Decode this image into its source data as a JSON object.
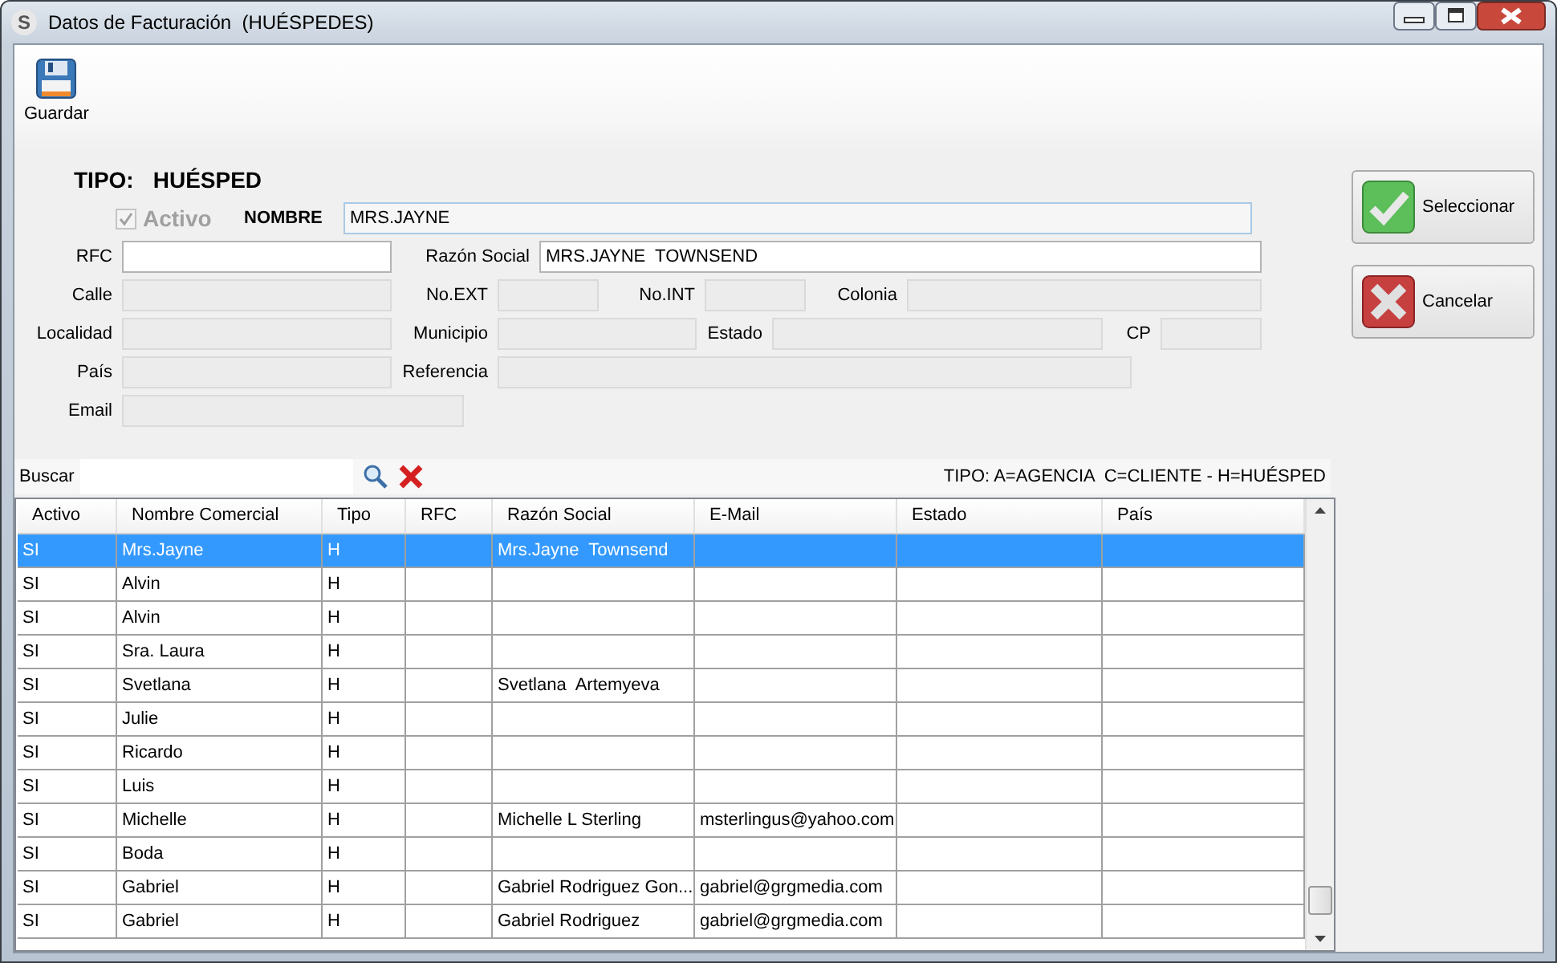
{
  "window": {
    "icon_letter": "S",
    "title": "Datos de Facturación  (HUÉSPEDES)"
  },
  "toolbar": [
    {
      "label": "Guardar"
    }
  ],
  "form": {
    "tipo_label": "TIPO:",
    "tipo_value": "HUÉSPED",
    "activo": {
      "label": "Activo",
      "checked": true,
      "disabled": true
    },
    "nombre": {
      "label": "NOMBRE",
      "value": "MRS.JAYNE"
    },
    "fields": [
      {
        "label": "RFC",
        "disabled": false
      },
      {
        "label": "Razón Social",
        "value": "MRS.JAYNE  TOWNSEND",
        "disabled": false
      },
      {
        "label": "Calle",
        "disabled": true
      },
      {
        "label": "No.EXT",
        "disabled": true
      },
      {
        "label": "No.INT",
        "disabled": true
      },
      {
        "label": "Colonia",
        "disabled": true
      },
      {
        "label": "Localidad",
        "disabled": true
      },
      {
        "label": "Municipio",
        "disabled": true
      },
      {
        "label": "Estado",
        "disabled": true
      },
      {
        "label": "CP",
        "disabled": true
      },
      {
        "label": "País",
        "disabled": true
      },
      {
        "label": "Referencia",
        "disabled": true
      },
      {
        "label": "Email",
        "disabled": true
      }
    ]
  },
  "actions": [
    {
      "kind": "accept",
      "label": "Seleccionar"
    },
    {
      "kind": "cancel",
      "label": "Cancelar"
    }
  ],
  "search": {
    "label": "Buscar",
    "legend": "TIPO: A=AGENCIA  C=CLIENTE - H=HUÉSPED"
  },
  "table": {
    "columns": [
      "Activo",
      "Nombre Comercial",
      "Tipo",
      "RFC",
      "Razón Social",
      "E-Mail",
      "Estado",
      "País"
    ],
    "rows": [
      {
        "selected": true,
        "activo": "SI",
        "nombre": "Mrs.Jayne",
        "tipo": "H",
        "razon_social": "Mrs.Jayne  Townsend"
      },
      {
        "selected": false,
        "activo": "SI",
        "nombre": "Alvin",
        "tipo": "H"
      },
      {
        "selected": false,
        "activo": "SI",
        "nombre": "Alvin",
        "tipo": "H"
      },
      {
        "selected": false,
        "activo": "SI",
        "nombre": "Sra. Laura",
        "tipo": "H"
      },
      {
        "selected": false,
        "activo": "SI",
        "nombre": "Svetlana",
        "tipo": "H",
        "razon_social": "Svetlana  Artemyeva"
      },
      {
        "selected": false,
        "activo": "SI",
        "nombre": "Julie",
        "tipo": "H"
      },
      {
        "selected": false,
        "activo": "SI",
        "nombre": "Ricardo",
        "tipo": "H"
      },
      {
        "selected": false,
        "activo": "SI",
        "nombre": "Luis",
        "tipo": "H"
      },
      {
        "selected": false,
        "activo": "SI",
        "nombre": "Michelle",
        "tipo": "H",
        "razon_social": "Michelle L Sterling",
        "email": "msterlingus@yahoo.com"
      },
      {
        "selected": false,
        "activo": "SI",
        "nombre": "Boda",
        "tipo": "H"
      },
      {
        "selected": false,
        "activo": "SI",
        "nombre": "Gabriel",
        "tipo": "H",
        "razon_social": "Gabriel Rodriguez Gon...",
        "email": "gabriel@grgmedia.com"
      },
      {
        "selected": false,
        "activo": "SI",
        "nombre": "Gabriel",
        "tipo": "H",
        "razon_social": "Gabriel Rodriguez",
        "email": "gabriel@grgmedia.com"
      }
    ]
  }
}
